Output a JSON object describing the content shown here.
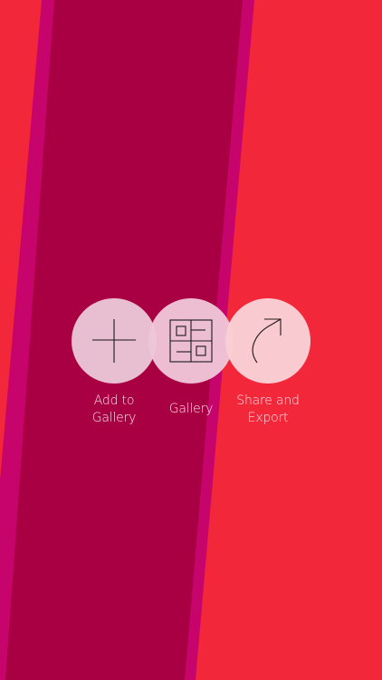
{
  "actions": [
    {
      "id": "add",
      "label": "Add to\nGallery",
      "icon": "plus-icon"
    },
    {
      "id": "gallery",
      "label": "Gallery",
      "icon": "grid-icon"
    },
    {
      "id": "share",
      "label": "Share and\nExport",
      "icon": "share-arrow-icon"
    }
  ],
  "colors": {
    "background": "#f2273a",
    "stripe_outer": "#c7046b",
    "stripe_inner": "#a80042",
    "circle_add": "#eac5d6",
    "circle_gallery": "#efc6d8",
    "circle_share": "#f9cfd3",
    "label": "#fbe3ec",
    "icon_stroke": "#1a1a1a"
  }
}
